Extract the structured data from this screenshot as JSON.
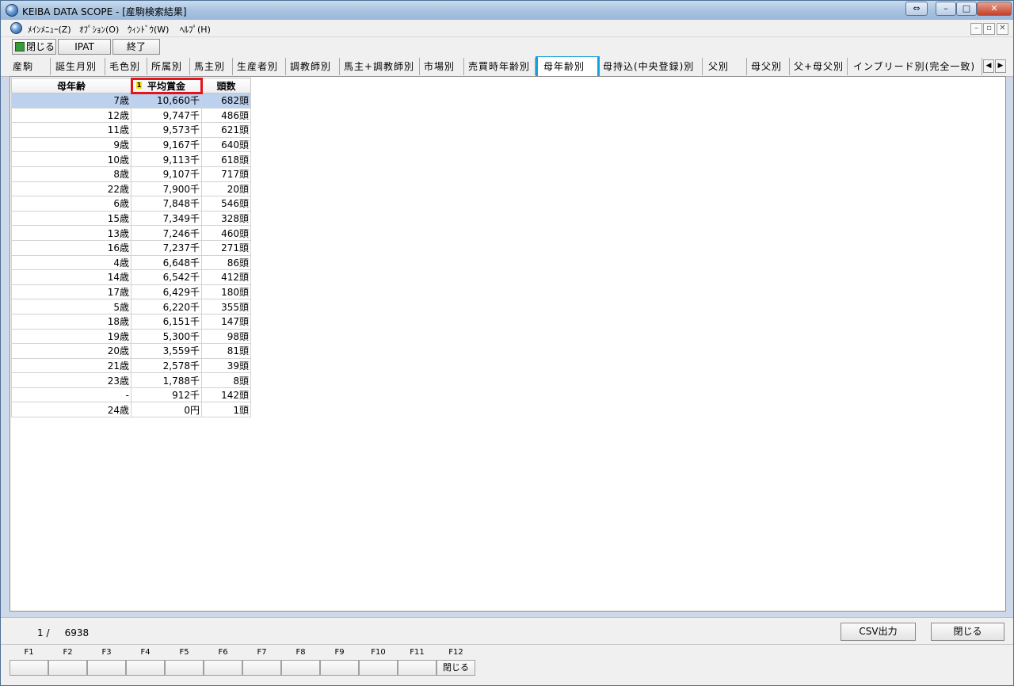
{
  "window": {
    "title": "KEIBA DATA SCOPE - [産駒検索結果]",
    "controls": {
      "switch": "⇔",
      "minimize": "–",
      "maximize": "□",
      "close": "✕"
    }
  },
  "menu": {
    "items": [
      "ﾒｲﾝﾒﾆｭｰ(Z)",
      "ｵﾌﾟｼｮﾝ(O)",
      "ｳｨﾝﾄﾞｳ(W)",
      "ﾍﾙﾌﾟ(H)"
    ],
    "mdi": {
      "minimize": "–",
      "restore": "▫",
      "close": "✕"
    }
  },
  "toolbar": {
    "close_label": "閉じる",
    "ipat_label": "IPAT",
    "exit_label": "終了"
  },
  "tabs": {
    "items": [
      "産駒",
      "誕生月別",
      "毛色別",
      "所属別",
      "馬主別",
      "生産者別",
      "調教師別",
      "馬主+調教師別",
      "市場別",
      "売買時年齢別",
      "母年齢別",
      "母持込(中央登録)別",
      "父別",
      "母父別",
      "父+母父別",
      "インブリード別(完全一致)"
    ],
    "active": "母年齢別",
    "scroll_left": "◀",
    "scroll_right": "▶"
  },
  "grid": {
    "headers": [
      "母年齢",
      "平均賞金",
      "頭数"
    ],
    "sort_badge": "1",
    "rows": [
      [
        "7歳",
        "10,660千",
        "682頭"
      ],
      [
        "12歳",
        "9,747千",
        "486頭"
      ],
      [
        "11歳",
        "9,573千",
        "621頭"
      ],
      [
        "9歳",
        "9,167千",
        "640頭"
      ],
      [
        "10歳",
        "9,113千",
        "618頭"
      ],
      [
        "8歳",
        "9,107千",
        "717頭"
      ],
      [
        "22歳",
        "7,900千",
        "20頭"
      ],
      [
        "6歳",
        "7,848千",
        "546頭"
      ],
      [
        "15歳",
        "7,349千",
        "328頭"
      ],
      [
        "13歳",
        "7,246千",
        "460頭"
      ],
      [
        "16歳",
        "7,237千",
        "271頭"
      ],
      [
        "4歳",
        "6,648千",
        "86頭"
      ],
      [
        "14歳",
        "6,542千",
        "412頭"
      ],
      [
        "17歳",
        "6,429千",
        "180頭"
      ],
      [
        "5歳",
        "6,220千",
        "355頭"
      ],
      [
        "18歳",
        "6,151千",
        "147頭"
      ],
      [
        "19歳",
        "5,300千",
        "98頭"
      ],
      [
        "20歳",
        "3,559千",
        "81頭"
      ],
      [
        "21歳",
        "2,578千",
        "39頭"
      ],
      [
        "23歳",
        "1,788千",
        "8頭"
      ],
      [
        "-",
        "912千",
        "142頭"
      ],
      [
        "24歳",
        "0円",
        "1頭"
      ]
    ]
  },
  "status": {
    "page": "1 /",
    "total": "6938",
    "csv_label": "CSV出力",
    "close_label": "閉じる"
  },
  "fkeys": {
    "labels": [
      "F1",
      "F2",
      "F3",
      "F4",
      "F5",
      "F6",
      "F7",
      "F8",
      "F9",
      "F10",
      "F11",
      "F12"
    ],
    "actions": [
      "",
      "",
      "",
      "",
      "",
      "",
      "",
      "",
      "",
      "",
      "",
      "閉じる"
    ]
  }
}
